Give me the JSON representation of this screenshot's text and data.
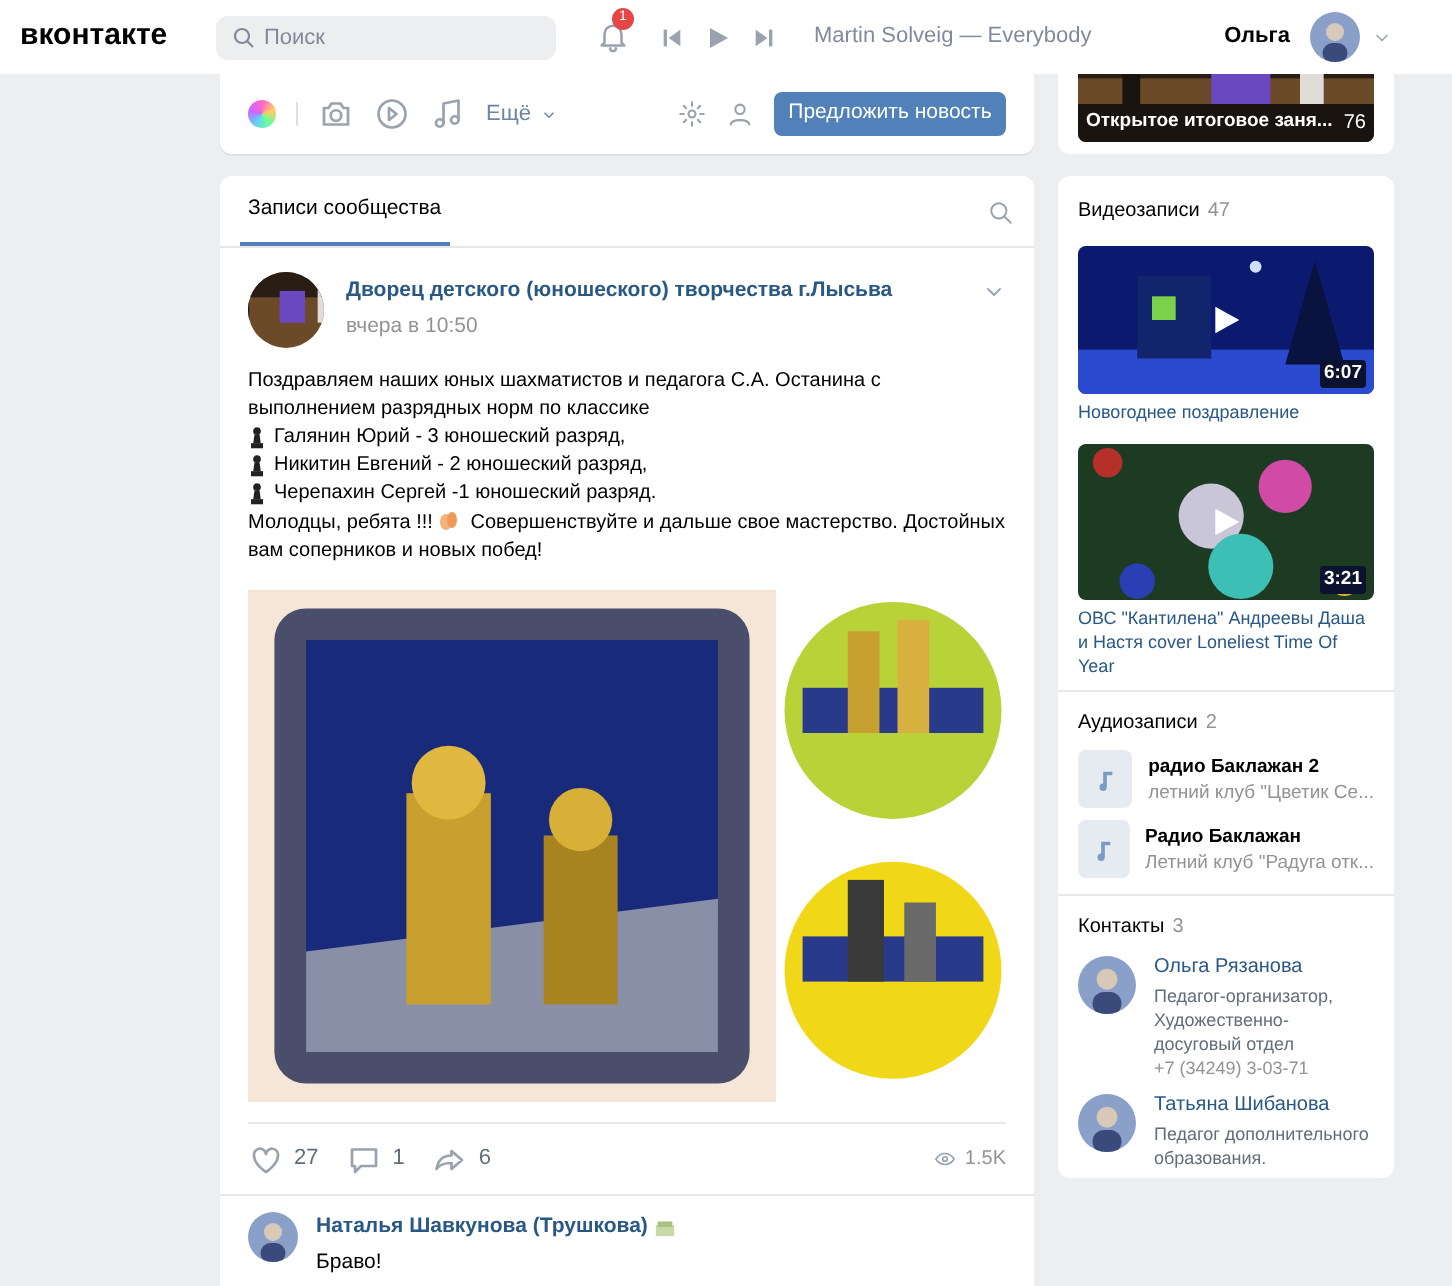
{
  "header": {
    "logo": "вконтакте",
    "search_placeholder": "Поиск",
    "notification_count": "1",
    "track": "Martin Solveig — Everybody",
    "user_name": "Ольга"
  },
  "composer": {
    "more_label": "Ещё",
    "suggest_button": "Предложить новость"
  },
  "feed": {
    "tabs": [
      {
        "label": "Записи сообщества",
        "selected": true
      }
    ],
    "post": {
      "author": "Дворец детского (юношеского) творчества г.Лысьва",
      "time": "вчера в 10:50",
      "lines": [
        {
          "kind": "plain",
          "text": "Поздравляем наших юных шахматистов и педагога С.А. Останина с выполнением разрядных норм по классике"
        },
        {
          "kind": "pawn",
          "text": "Галянин Юрий - 3 юношеский разряд,"
        },
        {
          "kind": "pawn",
          "text": "Никитин Евгений - 2 юношеский разряд,"
        },
        {
          "kind": "pawn",
          "text": "Черепахин Сергей -1 юношеский разряд."
        },
        {
          "kind": "clap",
          "text": "Молодцы, ребята !!!",
          "after": "Совершенствуйте и дальше свое мастерство. Достойных вам соперников и новых побед!"
        }
      ],
      "likes": "27",
      "comments": "1",
      "shares": "6",
      "views": "1.5K"
    },
    "comment": {
      "author": "Наталья Шавкунова (Трушкова)",
      "text": "Браво!"
    }
  },
  "sidebar": {
    "top_video": {
      "title": "Открытое итоговое заня...",
      "count": "76"
    },
    "videos": {
      "title": "Видеозаписи",
      "count": "47",
      "items": [
        {
          "duration": "6:07",
          "title": "Новогоднее поздравление"
        },
        {
          "duration": "3:21",
          "title": "ОВС \"Кантилена\" Андреевы Даша и Настя cover Loneliest Time Of Year"
        }
      ]
    },
    "audio": {
      "title": "Аудиозаписи",
      "count": "2",
      "items": [
        {
          "title": "радио Баклажан 2",
          "subtitle": "летний клуб \"Цветик Се..."
        },
        {
          "title": "Радио Баклажан",
          "subtitle": "Летний клуб \"Радуга отк..."
        }
      ]
    },
    "contacts": {
      "title": "Контакты",
      "count": "3",
      "items": [
        {
          "name": "Ольга Рязанова",
          "lines": [
            "Педагог-организатор, Художественно-досуговый отдел"
          ],
          "phone": "+7 (34249) 3-03-71"
        },
        {
          "name": "Татьяна Шибанова",
          "lines": [
            "Педагог дополнительного образования."
          ]
        }
      ]
    }
  }
}
